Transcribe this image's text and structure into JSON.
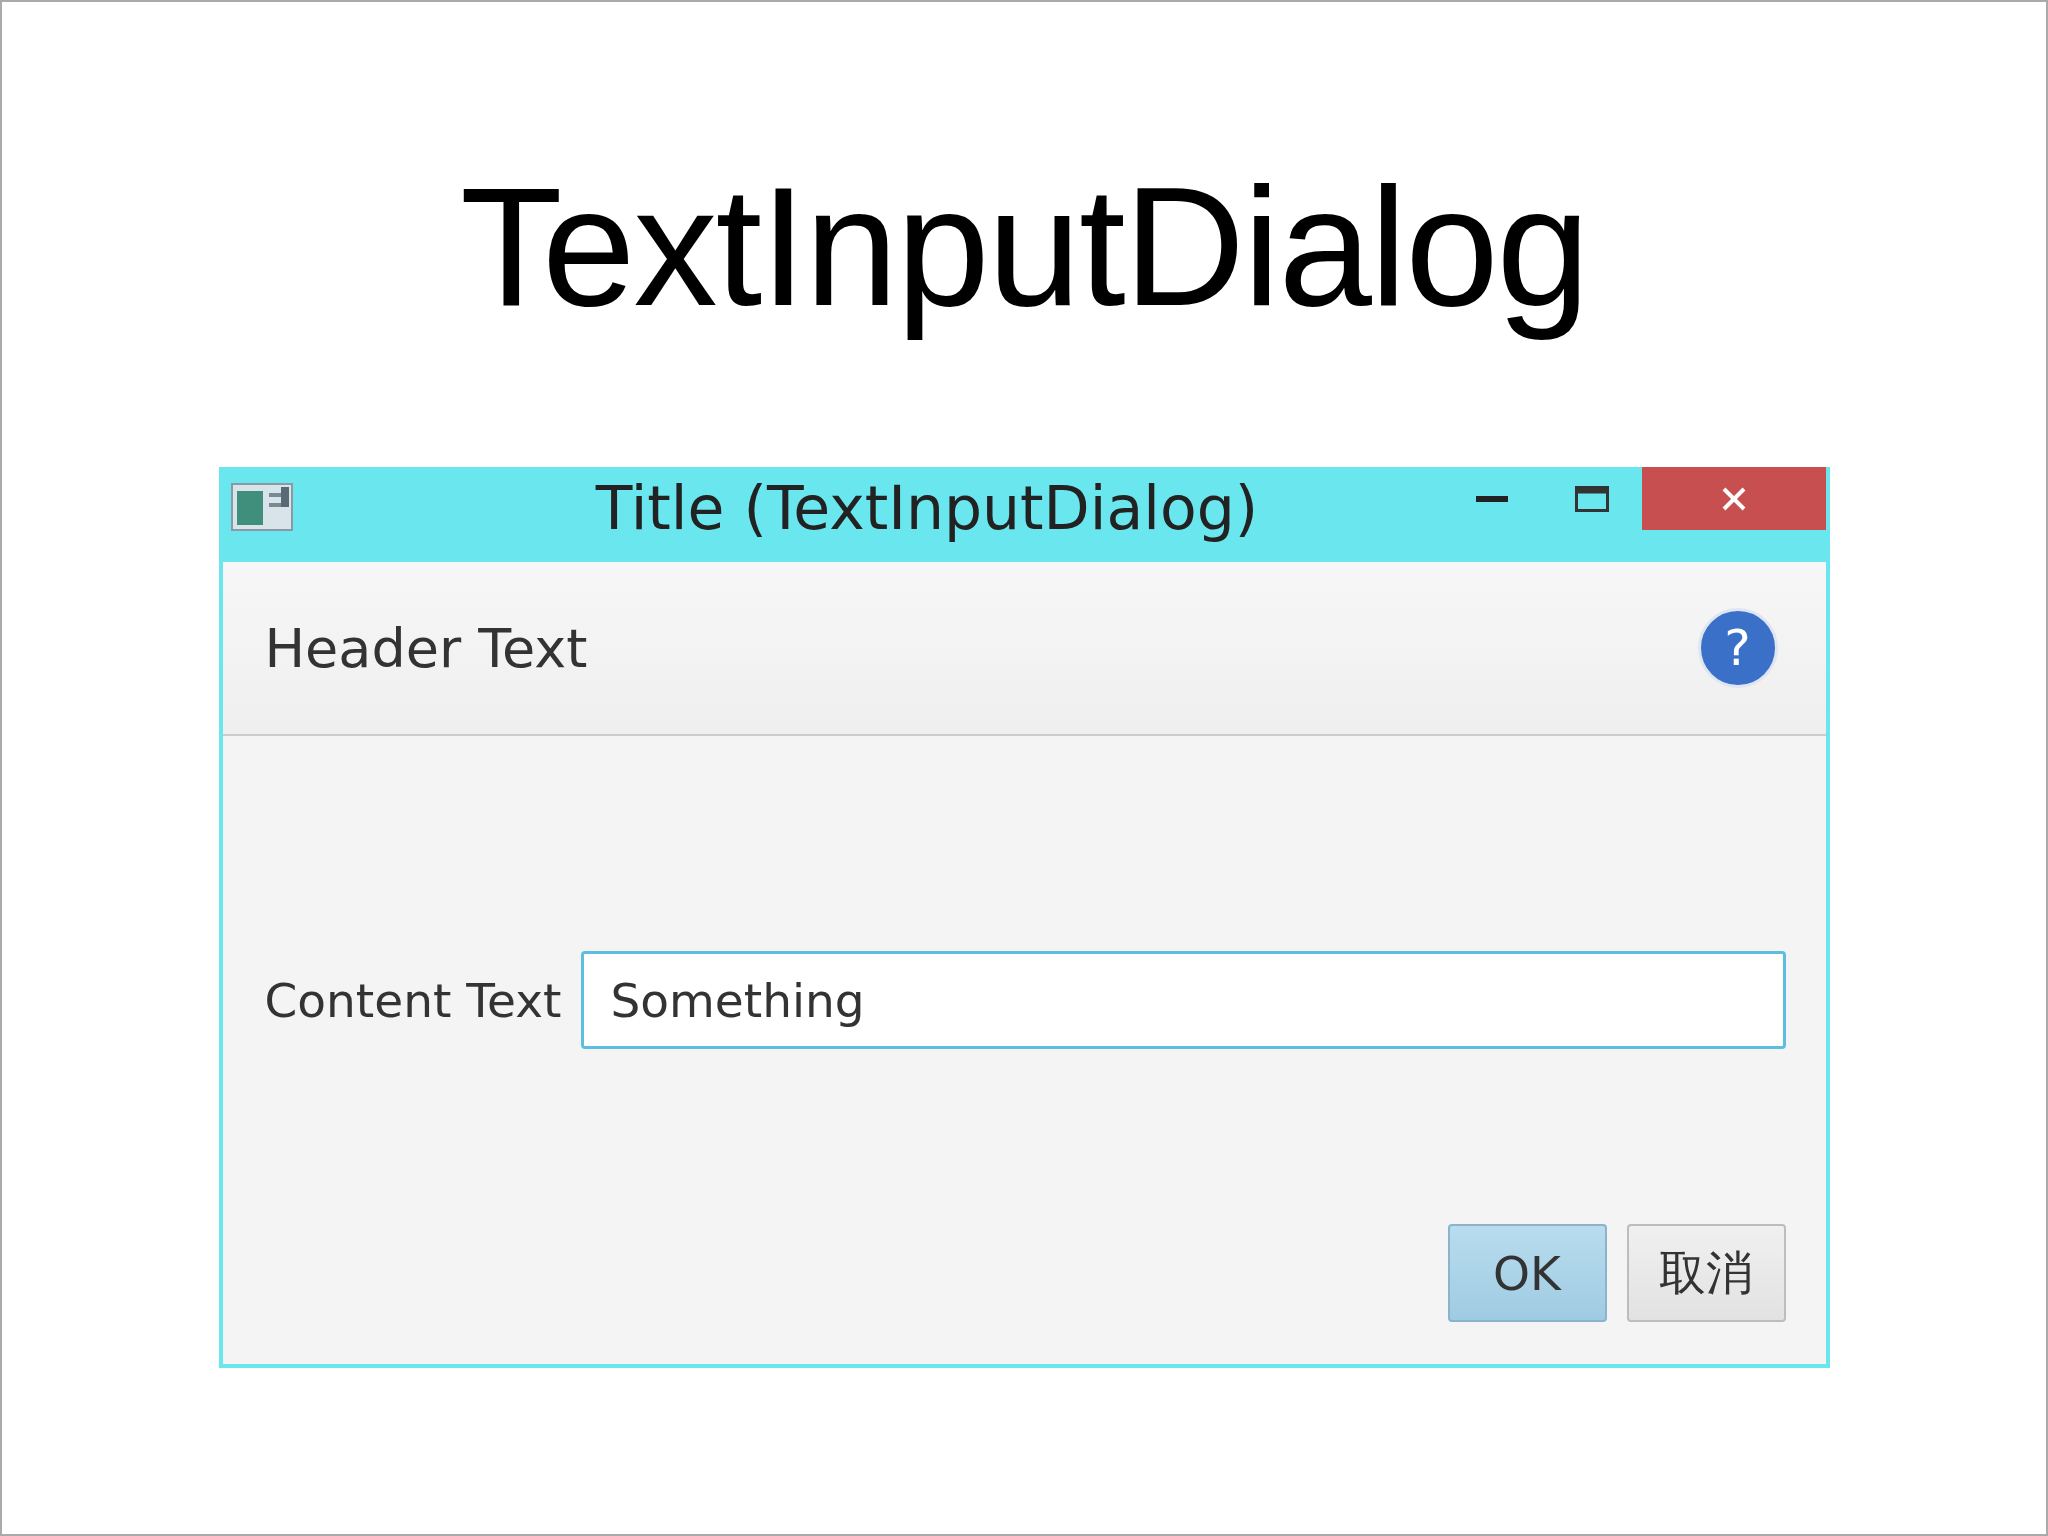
{
  "slide_title": "TextInputDialog",
  "window": {
    "title": "Title (TextInputDialog)"
  },
  "header": {
    "text": "Header Text",
    "help_icon": "?"
  },
  "content": {
    "label": "Content Text",
    "field": {
      "value": "Something"
    }
  },
  "buttons": [
    {
      "label": "OK",
      "kind": "default"
    },
    {
      "label": "取消",
      "kind": "normal"
    }
  ]
}
